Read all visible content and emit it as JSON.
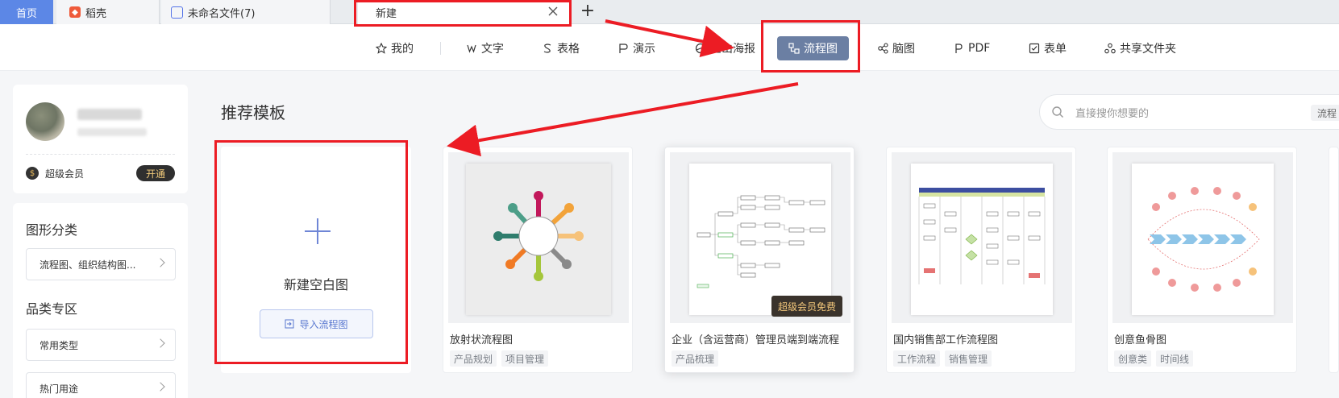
{
  "tabs": {
    "home": "首页",
    "daoke": "稻壳",
    "unnamed": "未命名文件(7)",
    "new": "新建"
  },
  "categories": [
    {
      "label": "我的",
      "icon": "star-icon"
    },
    {
      "label": "文字",
      "icon": "word-icon"
    },
    {
      "label": "表格",
      "icon": "sheet-icon"
    },
    {
      "label": "演示",
      "icon": "slides-icon"
    },
    {
      "label": "金山海报",
      "icon": "poster-icon"
    },
    {
      "label": "流程图",
      "icon": "flowchart-icon",
      "active": true
    },
    {
      "label": "脑图",
      "icon": "mindmap-icon"
    },
    {
      "label": "PDF",
      "icon": "pdf-icon"
    },
    {
      "label": "表单",
      "icon": "form-icon"
    },
    {
      "label": "共享文件夹",
      "icon": "shared-folder-icon"
    }
  ],
  "profile": {
    "vip_label": "超级会员",
    "vip_button": "开通"
  },
  "filters": {
    "section1_title": "图形分类",
    "section1_value": "流程图、组织结构图...",
    "section2_title": "品类专区",
    "section2_value1": "常用类型",
    "section2_value2": "热门用途"
  },
  "main": {
    "title": "推荐模板",
    "search_placeholder": "直接搜你想要的",
    "search_chip": "流程",
    "blank": {
      "label": "新建空白图",
      "import_button": "导入流程图"
    },
    "templates": [
      {
        "title": "放射状流程图",
        "tags": [
          "产品规划",
          "项目管理"
        ]
      },
      {
        "title": "企业（含运营商）管理员端到端流程",
        "tags": [
          "产品梳理"
        ],
        "badge": "超级会员免费"
      },
      {
        "title": "国内销售部工作流程图",
        "tags": [
          "工作流程",
          "销售管理"
        ]
      },
      {
        "title": "创意鱼骨图",
        "tags": [
          "创意类",
          "时间线"
        ]
      }
    ]
  },
  "colors": {
    "accent": "#5c87e6",
    "active_category": "#6b7fa3",
    "annotation": "#ec1c24"
  }
}
